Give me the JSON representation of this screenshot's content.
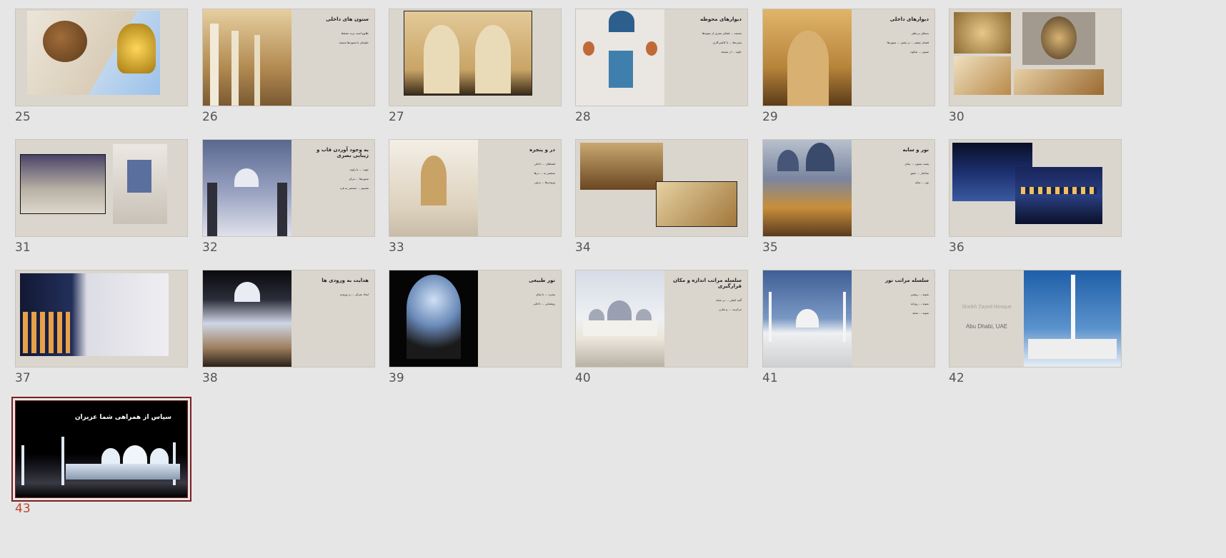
{
  "slides": [
    {
      "number": "25",
      "title": "",
      "bullets": [],
      "image": "dome-ceiling-with-golden-capital",
      "colors": [
        "#a7c7e8",
        "#d8c8a2",
        "#8a5a2b"
      ]
    },
    {
      "number": "26",
      "title": "ستون های داخلی",
      "bullets": [
        "طلوع است ترند محفظ",
        "جلوه‌ای با ستون‌ها مسجد"
      ],
      "image": "interior-columns",
      "colors": [
        "#c9a76a",
        "#7a5a32"
      ]
    },
    {
      "number": "27",
      "title": "",
      "bullets": [],
      "image": "interior-arches-gold",
      "colors": [
        "#d8b987",
        "#2a1d10"
      ]
    },
    {
      "number": "28",
      "title": "دیوارهای محوطه",
      "bullets": [
        "مسجد ... فضای بصری از نمونه‌ها",
        "پنجره‌ها ... با کاشی‌کاری",
        "جلوه ... از مسجد"
      ],
      "image": "calligraphy-wall",
      "colors": [
        "#e9e6e2",
        "#2b6a9a",
        "#c06a3a"
      ]
    },
    {
      "number": "29",
      "title": "دیوارهای داخلی",
      "bullets": [
        "بندهای بی‌نظیر",
        "فضای چشم ... در نقش ... ستون‌ها",
        "ستون ... شکوه"
      ],
      "image": "interior-walls-gold",
      "colors": [
        "#c89b52",
        "#5b3b19"
      ]
    },
    {
      "number": "30",
      "title": "",
      "bullets": [],
      "image": "chandelier-and-flower-motifs",
      "colors": [
        "#a07f3c",
        "#d2b58a",
        "#6a5a4a"
      ]
    },
    {
      "number": "31",
      "title": "",
      "bullets": [],
      "image": "ablution-room",
      "colors": [
        "#3a3a40",
        "#d7d3cb",
        "#5b4b7a"
      ]
    },
    {
      "number": "32",
      "title": "به وجود آوردن قاب و زیبایی بصری",
      "bullets": [
        "جهت ... با زاویه",
        "ستون‌ها ... مرکز",
        "تقسیم ... منحصر به فرد"
      ],
      "image": "domes-through-arches",
      "colors": [
        "#6a7aa5",
        "#c9cbd6"
      ]
    },
    {
      "number": "33",
      "title": "در و پنجره",
      "bullets": [
        "فضاهای ... داخلی",
        "منحصر به ... درها",
        "ورودی‌ها ... تزئین"
      ],
      "image": "marble-hall",
      "colors": [
        "#efe9df",
        "#c2a26a"
      ]
    },
    {
      "number": "34",
      "title": "",
      "bullets": [],
      "image": "golden-corridor",
      "colors": [
        "#a1773b",
        "#6a4722",
        "#e6d1a2"
      ]
    },
    {
      "number": "35",
      "title": "نور و سایه",
      "bullets": [
        "پشت ستون ... نمای",
        "ساختار ... عمق",
        "نور ... سایه"
      ],
      "image": "domes-corridor-sunset",
      "colors": [
        "#3a4a6a",
        "#c98f3a"
      ]
    },
    {
      "number": "36",
      "title": "",
      "bullets": [],
      "image": "night-reflection",
      "colors": [
        "#10183a",
        "#3a5aa0",
        "#f0c060"
      ]
    },
    {
      "number": "37",
      "title": "",
      "bullets": [],
      "image": "arches-at-night-with-floral-wall",
      "colors": [
        "#1a2040",
        "#e6e6ea",
        "#e8a04a"
      ]
    },
    {
      "number": "38",
      "title": "هدایت به ورودی ها",
      "bullets": [
        "ایجاد تمرکز ... بر ورودی"
      ],
      "image": "mosque-night-entrance",
      "colors": [
        "#0c0c10",
        "#cfd6e6",
        "#e0a44a"
      ]
    },
    {
      "number": "39",
      "title": "نور طبیعی",
      "bullets": [
        "پنجره ... با نمای",
        "روشنایی ... داخلی"
      ],
      "image": "window-lattice",
      "colors": [
        "#000000",
        "#8fb4e0",
        "#efe0c0"
      ]
    },
    {
      "number": "40",
      "title": "سلسله مراتب اندازه و مکان قرارگیری",
      "bullets": [
        "گنبد اصلی ... در میانه",
        "مرکزیت ... و تقارن"
      ],
      "image": "mosque-courtyard-day",
      "colors": [
        "#cfd6e2",
        "#efece6",
        "#8a8fa0"
      ]
    },
    {
      "number": "41",
      "title": "سلسله مراتب نور",
      "bullets": [
        "نمونه ... روشن",
        "نمونه ... روزانه",
        "نمونه ... سایه"
      ],
      "image": "mosque-minarets-day",
      "colors": [
        "#4a6aa0",
        "#f3f3f3"
      ]
    },
    {
      "number": "42",
      "title": "",
      "bullets": [],
      "title_en": "Sheikh Zayed Mosque",
      "subtitle_en": "Abu Dhabi, UAE",
      "image": "minaret-blue-sky",
      "colors": [
        "#2a6ab0",
        "#f5f5f5"
      ]
    },
    {
      "number": "43",
      "title": "سپاس از همراهی شما عزیزان",
      "bullets": [],
      "image": "mosque-night-panorama",
      "colors": [
        "#000000",
        "#e6eef8"
      ],
      "selected": true
    }
  ],
  "ui": {
    "background": "#e6e6e6",
    "slide_bg": "#dad6ce",
    "active_number_color": "#c0462c",
    "selection_border": "#7a1f1f"
  }
}
